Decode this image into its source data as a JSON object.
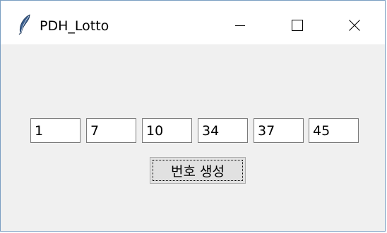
{
  "window": {
    "title": "PDH_Lotto",
    "icon": "feather-icon",
    "controls": {
      "minimize": "minimize-icon",
      "maximize": "maximize-icon",
      "close": "close-icon"
    }
  },
  "numbers": [
    "1",
    "7",
    "10",
    "34",
    "37",
    "45"
  ],
  "generate_button": {
    "label": "번호 생성"
  }
}
